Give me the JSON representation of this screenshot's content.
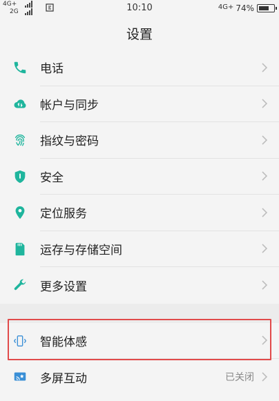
{
  "status_bar": {
    "network1_top": "4G+",
    "network1_bottom": "2G",
    "time": "10:10",
    "network2": "4G+",
    "battery_percent": "74%",
    "battery_level": 0.74
  },
  "header": {
    "title": "设置"
  },
  "colors": {
    "accent": "#1fb59d",
    "highlight_border": "#e14a4a",
    "chevron": "#bdbdbd"
  },
  "groups": [
    {
      "items": [
        {
          "label": "电话",
          "icon": "phone-icon"
        },
        {
          "label": "帐户与同步",
          "icon": "cloud-sync-icon"
        },
        {
          "label": "指纹与密码",
          "icon": "fingerprint-icon"
        },
        {
          "label": "安全",
          "icon": "shield-icon"
        },
        {
          "label": "定位服务",
          "icon": "location-pin-icon"
        },
        {
          "label": "运存与存储空间",
          "icon": "sd-card-icon"
        },
        {
          "label": "更多设置",
          "icon": "wrench-icon"
        }
      ]
    },
    {
      "items": [
        {
          "label": "智能体感",
          "icon": "motion-phone-icon",
          "highlighted": true
        },
        {
          "label": "多屏互动",
          "icon": "screen-cast-icon",
          "status": "已关闭"
        }
      ]
    }
  ]
}
